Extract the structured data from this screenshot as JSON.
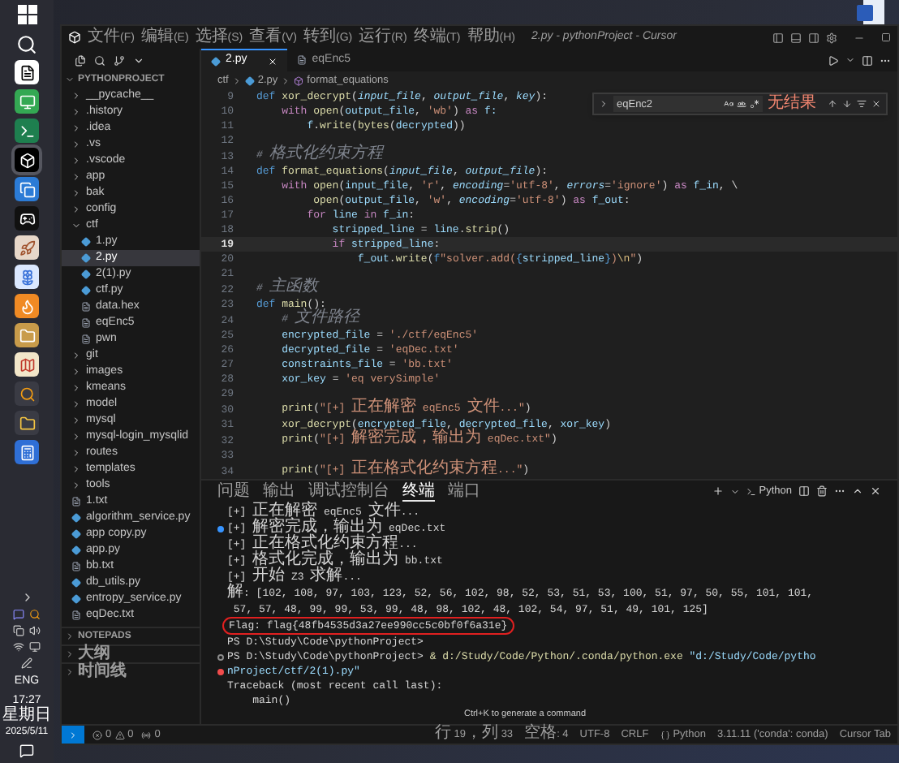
{
  "taskbar": {
    "language": "ENG",
    "time": "17:27",
    "weekday": "星期日",
    "date": "2025/5/11"
  },
  "window": {
    "title": "2.py - pythonProject - Cursor",
    "menu": [
      "文件(F)",
      "编辑(E)",
      "选择(S)",
      "查看(V)",
      "转到(G)",
      "运行(R)",
      "终端(T)",
      "帮助(H)"
    ]
  },
  "sidebar": {
    "project": "PYTHONPROJECT",
    "tree": [
      {
        "name": "__pycache__",
        "kind": "folder",
        "expanded": false,
        "selected": false
      },
      {
        "name": ".history",
        "kind": "folder",
        "expanded": false,
        "selected": false
      },
      {
        "name": ".idea",
        "kind": "folder",
        "expanded": false,
        "selected": false
      },
      {
        "name": ".vs",
        "kind": "folder",
        "expanded": false,
        "selected": false
      },
      {
        "name": ".vscode",
        "kind": "folder",
        "expanded": false,
        "selected": false
      },
      {
        "name": "app",
        "kind": "folder",
        "expanded": false,
        "selected": false
      },
      {
        "name": "bak",
        "kind": "folder",
        "expanded": false,
        "selected": false
      },
      {
        "name": "config",
        "kind": "folder",
        "expanded": false,
        "selected": false
      },
      {
        "name": "ctf",
        "kind": "folder",
        "expanded": true,
        "selected": false,
        "children": [
          {
            "name": "1.py",
            "kind": "python",
            "selected": false
          },
          {
            "name": "2.py",
            "kind": "python",
            "selected": true
          },
          {
            "name": "2(1).py",
            "kind": "python",
            "selected": false
          },
          {
            "name": "ctf.py",
            "kind": "python",
            "selected": false
          },
          {
            "name": "data.hex",
            "kind": "file",
            "selected": false
          },
          {
            "name": "eqEnc5",
            "kind": "file",
            "selected": false
          },
          {
            "name": "pwn",
            "kind": "file",
            "selected": false
          }
        ]
      },
      {
        "name": "git",
        "kind": "folder",
        "expanded": false,
        "selected": false
      },
      {
        "name": "images",
        "kind": "folder",
        "expanded": false,
        "selected": false
      },
      {
        "name": "kmeans",
        "kind": "folder",
        "expanded": false,
        "selected": false
      },
      {
        "name": "model",
        "kind": "folder",
        "expanded": false,
        "selected": false
      },
      {
        "name": "mysql",
        "kind": "folder",
        "expanded": false,
        "selected": false
      },
      {
        "name": "mysql-login_mysqlid",
        "kind": "folder",
        "expanded": false,
        "selected": false
      },
      {
        "name": "routes",
        "kind": "folder",
        "expanded": false,
        "selected": false
      },
      {
        "name": "templates",
        "kind": "folder",
        "expanded": false,
        "selected": false
      },
      {
        "name": "tools",
        "kind": "folder",
        "expanded": false,
        "selected": false
      },
      {
        "name": "1.txt",
        "kind": "file",
        "selected": false
      },
      {
        "name": "algorithm_service.py",
        "kind": "python",
        "selected": false
      },
      {
        "name": "app copy.py",
        "kind": "python",
        "selected": false
      },
      {
        "name": "app.py",
        "kind": "python",
        "selected": false
      },
      {
        "name": "bb.txt",
        "kind": "file",
        "selected": false
      },
      {
        "name": "db_utils.py",
        "kind": "python",
        "selected": false
      },
      {
        "name": "entropy_service.py",
        "kind": "python",
        "selected": false
      },
      {
        "name": "eqDec.txt",
        "kind": "file",
        "selected": false
      }
    ],
    "sections": [
      "NOTEPADS",
      "大纲",
      "时间线"
    ]
  },
  "editor": {
    "tabs": [
      {
        "label": "2.py",
        "kind": "python",
        "selected": true
      },
      {
        "label": "eqEnc5",
        "kind": "file",
        "selected": false
      }
    ],
    "breadcrumb": [
      {
        "label": "ctf",
        "kind": "folder"
      },
      {
        "label": "2.py",
        "kind": "python"
      },
      {
        "label": "format_equations",
        "kind": "symbol"
      }
    ],
    "find": {
      "query": "eqEnc2",
      "result": "无结果"
    },
    "lines": [
      {
        "number": "9",
        "current": false,
        "tokens": [
          {
            "text": "def ",
            "kind": "keyword"
          },
          {
            "text": "xor_decrypt",
            "kind": "function"
          },
          {
            "text": "(",
            "kind": "plain"
          },
          {
            "text": "input_file",
            "kind": "param"
          },
          {
            "text": ", ",
            "kind": "plain"
          },
          {
            "text": "output_file",
            "kind": "param"
          },
          {
            "text": ", ",
            "kind": "plain"
          },
          {
            "text": "key",
            "kind": "param"
          },
          {
            "text": "):",
            "kind": "plain"
          }
        ]
      },
      {
        "number": "10",
        "current": false,
        "tokens": [
          {
            "text": "    with ",
            "kind": "control"
          },
          {
            "text": "open",
            "kind": "function"
          },
          {
            "text": "(",
            "kind": "plain"
          },
          {
            "text": "output_file",
            "kind": "var"
          },
          {
            "text": ", ",
            "kind": "plain"
          },
          {
            "text": "'wb'",
            "kind": "string"
          },
          {
            "text": ") ",
            "kind": "plain"
          },
          {
            "text": "as",
            "kind": "control"
          },
          {
            "text": " f:",
            "kind": "var"
          }
        ]
      },
      {
        "number": "11",
        "current": false,
        "tokens": [
          {
            "text": "        f",
            "kind": "var"
          },
          {
            "text": ".",
            "kind": "plain"
          },
          {
            "text": "write",
            "kind": "function"
          },
          {
            "text": "(",
            "kind": "plain"
          },
          {
            "text": "bytes",
            "kind": "function"
          },
          {
            "text": "(",
            "kind": "plain"
          },
          {
            "text": "decrypted",
            "kind": "var"
          },
          {
            "text": "))",
            "kind": "plain"
          }
        ]
      },
      {
        "number": "12",
        "current": false
      },
      {
        "number": "13",
        "current": false,
        "tokens": [
          {
            "text": "# 格式化约束方程",
            "kind": "comment"
          }
        ]
      },
      {
        "number": "14",
        "current": false,
        "tokens": [
          {
            "text": "def ",
            "kind": "keyword"
          },
          {
            "text": "format_equations",
            "kind": "function"
          },
          {
            "text": "(",
            "kind": "plain"
          },
          {
            "text": "input_file",
            "kind": "param"
          },
          {
            "text": ", ",
            "kind": "plain"
          },
          {
            "text": "output_file",
            "kind": "param"
          },
          {
            "text": "):",
            "kind": "plain"
          }
        ]
      },
      {
        "number": "15",
        "current": false,
        "tokens": [
          {
            "text": "    with ",
            "kind": "control"
          },
          {
            "text": "open",
            "kind": "function"
          },
          {
            "text": "(",
            "kind": "plain"
          },
          {
            "text": "input_file",
            "kind": "var"
          },
          {
            "text": ", ",
            "kind": "plain"
          },
          {
            "text": "'r'",
            "kind": "string"
          },
          {
            "text": ", ",
            "kind": "plain"
          },
          {
            "text": "encoding",
            "kind": "param"
          },
          {
            "text": "=",
            "kind": "plain"
          },
          {
            "text": "'utf-8'",
            "kind": "string"
          },
          {
            "text": ", ",
            "kind": "plain"
          },
          {
            "text": "errors",
            "kind": "param"
          },
          {
            "text": "=",
            "kind": "plain"
          },
          {
            "text": "'ignore'",
            "kind": "string"
          },
          {
            "text": ") ",
            "kind": "plain"
          },
          {
            "text": "as",
            "kind": "control"
          },
          {
            "text": " f_in",
            "kind": "var"
          },
          {
            "text": ", \\",
            "kind": "plain"
          }
        ]
      },
      {
        "number": "16",
        "current": false,
        "tokens": [
          {
            "text": "         open",
            "kind": "function"
          },
          {
            "text": "(",
            "kind": "plain"
          },
          {
            "text": "output_file",
            "kind": "var"
          },
          {
            "text": ", ",
            "kind": "plain"
          },
          {
            "text": "'w'",
            "kind": "string"
          },
          {
            "text": ", ",
            "kind": "plain"
          },
          {
            "text": "encoding",
            "kind": "param"
          },
          {
            "text": "=",
            "kind": "plain"
          },
          {
            "text": "'utf-8'",
            "kind": "string"
          },
          {
            "text": ") ",
            "kind": "plain"
          },
          {
            "text": "as",
            "kind": "control"
          },
          {
            "text": " f_out",
            "kind": "var"
          },
          {
            "text": ":",
            "kind": "plain"
          }
        ]
      },
      {
        "number": "17",
        "current": false,
        "tokens": [
          {
            "text": "        for ",
            "kind": "control"
          },
          {
            "text": "line ",
            "kind": "var"
          },
          {
            "text": "in",
            "kind": "control"
          },
          {
            "text": " f_in",
            "kind": "var"
          },
          {
            "text": ":",
            "kind": "plain"
          }
        ]
      },
      {
        "number": "18",
        "current": false,
        "tokens": [
          {
            "text": "            stripped_line",
            "kind": "var"
          },
          {
            "text": " = ",
            "kind": "plain"
          },
          {
            "text": "line",
            "kind": "var"
          },
          {
            "text": ".",
            "kind": "plain"
          },
          {
            "text": "strip",
            "kind": "function"
          },
          {
            "text": "()",
            "kind": "plain"
          }
        ]
      },
      {
        "number": "19",
        "current": true,
        "tokens": [
          {
            "text": "            if ",
            "kind": "control"
          },
          {
            "text": "stripped_line",
            "kind": "var"
          },
          {
            "text": ":",
            "kind": "plain"
          }
        ]
      },
      {
        "number": "20",
        "current": false,
        "tokens": [
          {
            "text": "                f_out",
            "kind": "var"
          },
          {
            "text": ".",
            "kind": "plain"
          },
          {
            "text": "write",
            "kind": "function"
          },
          {
            "text": "(",
            "kind": "plain"
          },
          {
            "text": "f",
            "kind": "keyword"
          },
          {
            "text": "\"solver.add(",
            "kind": "string"
          },
          {
            "text": "{",
            "kind": "keyword"
          },
          {
            "text": "stripped_line",
            "kind": "var"
          },
          {
            "text": "}",
            "kind": "keyword"
          },
          {
            "text": ")",
            "kind": "string"
          },
          {
            "text": "\\n",
            "kind": "escape"
          },
          {
            "text": "\"",
            "kind": "string"
          },
          {
            "text": ")",
            "kind": "plain"
          }
        ]
      },
      {
        "number": "21",
        "current": false
      },
      {
        "number": "22",
        "current": false,
        "tokens": [
          {
            "text": "# 主函数",
            "kind": "comment"
          }
        ]
      },
      {
        "number": "23",
        "current": false,
        "tokens": [
          {
            "text": "def ",
            "kind": "keyword"
          },
          {
            "text": "main",
            "kind": "function"
          },
          {
            "text": "():",
            "kind": "plain"
          }
        ]
      },
      {
        "number": "24",
        "current": false,
        "tokens": [
          {
            "text": "    # 文件路径",
            "kind": "comment"
          }
        ]
      },
      {
        "number": "25",
        "current": false,
        "tokens": [
          {
            "text": "    encrypted_file",
            "kind": "var"
          },
          {
            "text": " = ",
            "kind": "plain"
          },
          {
            "text": "'./ctf/eqEnc5'",
            "kind": "string"
          }
        ]
      },
      {
        "number": "26",
        "current": false,
        "tokens": [
          {
            "text": "    decrypted_file",
            "kind": "var"
          },
          {
            "text": " = ",
            "kind": "plain"
          },
          {
            "text": "'eqDec.txt'",
            "kind": "string"
          }
        ]
      },
      {
        "number": "27",
        "current": false,
        "tokens": [
          {
            "text": "    constraints_file",
            "kind": "var"
          },
          {
            "text": " = ",
            "kind": "plain"
          },
          {
            "text": "'bb.txt'",
            "kind": "string"
          }
        ]
      },
      {
        "number": "28",
        "current": false,
        "tokens": [
          {
            "text": "    xor_key",
            "kind": "var"
          },
          {
            "text": " = ",
            "kind": "plain"
          },
          {
            "text": "'eq verySimple'",
            "kind": "string"
          }
        ]
      },
      {
        "number": "29",
        "current": false
      },
      {
        "number": "30",
        "current": false,
        "tokens": [
          {
            "text": "    print",
            "kind": "function"
          },
          {
            "text": "(",
            "kind": "plain"
          },
          {
            "text": "\"[+] 正在解密 eqEnc5 文件...\"",
            "kind": "string"
          },
          {
            "text": ")",
            "kind": "plain"
          }
        ]
      },
      {
        "number": "31",
        "current": false,
        "tokens": [
          {
            "text": "    xor_decrypt",
            "kind": "function"
          },
          {
            "text": "(",
            "kind": "plain"
          },
          {
            "text": "encrypted_file",
            "kind": "var"
          },
          {
            "text": ", ",
            "kind": "plain"
          },
          {
            "text": "decrypted_file",
            "kind": "var"
          },
          {
            "text": ", ",
            "kind": "plain"
          },
          {
            "text": "xor_key",
            "kind": "var"
          },
          {
            "text": ")",
            "kind": "plain"
          }
        ]
      },
      {
        "number": "32",
        "current": false,
        "tokens": [
          {
            "text": "    print",
            "kind": "function"
          },
          {
            "text": "(",
            "kind": "plain"
          },
          {
            "text": "\"[+] 解密完成，输出为 eqDec.txt\"",
            "kind": "string"
          },
          {
            "text": ")",
            "kind": "plain"
          }
        ]
      },
      {
        "number": "33",
        "current": false
      },
      {
        "number": "34",
        "current": false,
        "tokens": [
          {
            "text": "    print",
            "kind": "function"
          },
          {
            "text": "(",
            "kind": "plain"
          },
          {
            "text": "\"[+] 正在格式化约束方程...\"",
            "kind": "string"
          },
          {
            "text": ")",
            "kind": "plain"
          }
        ]
      }
    ]
  },
  "panel": {
    "tabs": [
      {
        "label": "问题",
        "selected": false
      },
      {
        "label": "输出",
        "selected": false
      },
      {
        "label": "调试控制台",
        "selected": false
      },
      {
        "label": "终端",
        "selected": true
      },
      {
        "label": "端口",
        "selected": false
      }
    ],
    "terminal_name": "Python",
    "lines": [
      {
        "kind": "plain",
        "circled": false,
        "tokens": [
          {
            "text": "[+] 正在解密 eqEnc5 文件...",
            "kind": "plain"
          }
        ]
      },
      {
        "kind": "info",
        "circled": false,
        "tokens": [
          {
            "text": "[+] 解密完成，输出为 eqDec.txt",
            "kind": "plain"
          }
        ]
      },
      {
        "kind": "plain",
        "circled": false,
        "tokens": [
          {
            "text": "[+] 正在格式化约束方程...",
            "kind": "plain"
          }
        ]
      },
      {
        "kind": "plain",
        "circled": false,
        "tokens": [
          {
            "text": "[+] 格式化完成，输出为 bb.txt",
            "kind": "plain"
          }
        ]
      },
      {
        "kind": "plain",
        "circled": false,
        "tokens": [
          {
            "text": "[+] 开始 Z3 求解...",
            "kind": "plain"
          }
        ]
      },
      {
        "kind": "plain",
        "circled": false,
        "tokens": [
          {
            "text": "解: [102, 108, 97, 103, 123, 52, 56, 102, 98, 52, 53, 51, 53, 100, 51, 97, 50, 55, 101, 101,",
            "kind": "plain"
          }
        ]
      },
      {
        "kind": "plain",
        "circled": false,
        "tokens": [
          {
            "text": " 57, 57, 48, 99, 99, 53, 99, 48, 98, 102, 48, 102, 54, 97, 51, 49, 101, 125]",
            "kind": "plain"
          }
        ]
      },
      {
        "kind": "plain",
        "circled": true,
        "tokens": [
          {
            "text": "Flag: flag{48fb4535d3a27ee990cc5c0bf0f6a31e}",
            "kind": "plain"
          }
        ]
      },
      {
        "kind": "plain",
        "circled": false,
        "tokens": [
          {
            "text": "PS D:\\Study\\Code\\pythonProject>",
            "kind": "plain"
          }
        ]
      },
      {
        "kind": "success",
        "circled": false,
        "tokens": [
          {
            "text": "PS D:\\Study\\Code\\pythonProject> ",
            "kind": "plain"
          },
          {
            "text": "& d:/Study/Code/Python/.conda/python.exe",
            "kind": "command"
          },
          {
            "text": " \"d:/Study/Code/pytho",
            "kind": "argument"
          }
        ]
      },
      {
        "kind": "error",
        "circled": false,
        "tokens": [
          {
            "text": "nProject/ctf/2(1).py\"",
            "kind": "argument"
          }
        ]
      },
      {
        "kind": "plain",
        "circled": false,
        "tokens": [
          {
            "text": "Traceback (most recent call last):",
            "kind": "plain"
          }
        ]
      },
      {
        "kind": "plain",
        "circled": false,
        "tokens": [
          {
            "text": "    main()",
            "kind": "plain"
          }
        ]
      }
    ],
    "hint": "Ctrl+K to generate a command"
  },
  "status_bar": {
    "errors": "0",
    "warnings": "0",
    "ports": "0",
    "items": [
      {
        "text": "行 19，列 33",
        "kind": "text"
      },
      {
        "text": "空格: 4",
        "kind": "text"
      },
      {
        "text": "UTF-8",
        "kind": "text"
      },
      {
        "text": "CRLF",
        "kind": "text"
      },
      {
        "text": "Python",
        "kind": "language"
      },
      {
        "text": "3.11.11 ('conda': conda)",
        "kind": "text"
      },
      {
        "text": "Cursor Tab",
        "kind": "text"
      }
    ]
  }
}
